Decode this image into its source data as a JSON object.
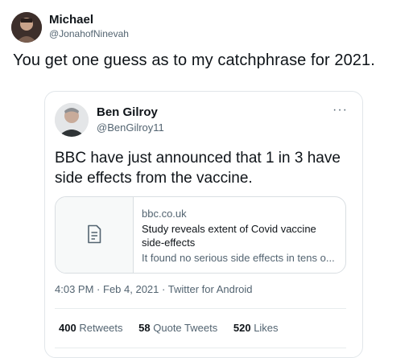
{
  "tweet": {
    "author": {
      "name": "Michael",
      "handle": "@JonahofNinevah"
    },
    "text": "You get one guess as to my catchphrase for 2021."
  },
  "quoted_tweet": {
    "author": {
      "name": "Ben Gilroy",
      "handle": "@BenGilroy11"
    },
    "text": "BBC have just announced that 1 in 3 have side effects from the vaccine.",
    "link_card": {
      "domain": "bbc.co.uk",
      "title": "Study reveals extent of Covid vaccine side-effects",
      "description": "It found no serious side effects in tens o...",
      "icon": "document-icon"
    },
    "time": "4:03 PM",
    "date": "Feb 4, 2021",
    "source": "Twitter for Android",
    "stats": {
      "retweets_count": "400",
      "retweets_label": "Retweets",
      "quotes_count": "58",
      "quotes_label": "Quote Tweets",
      "likes_count": "520",
      "likes_label": "Likes"
    }
  }
}
